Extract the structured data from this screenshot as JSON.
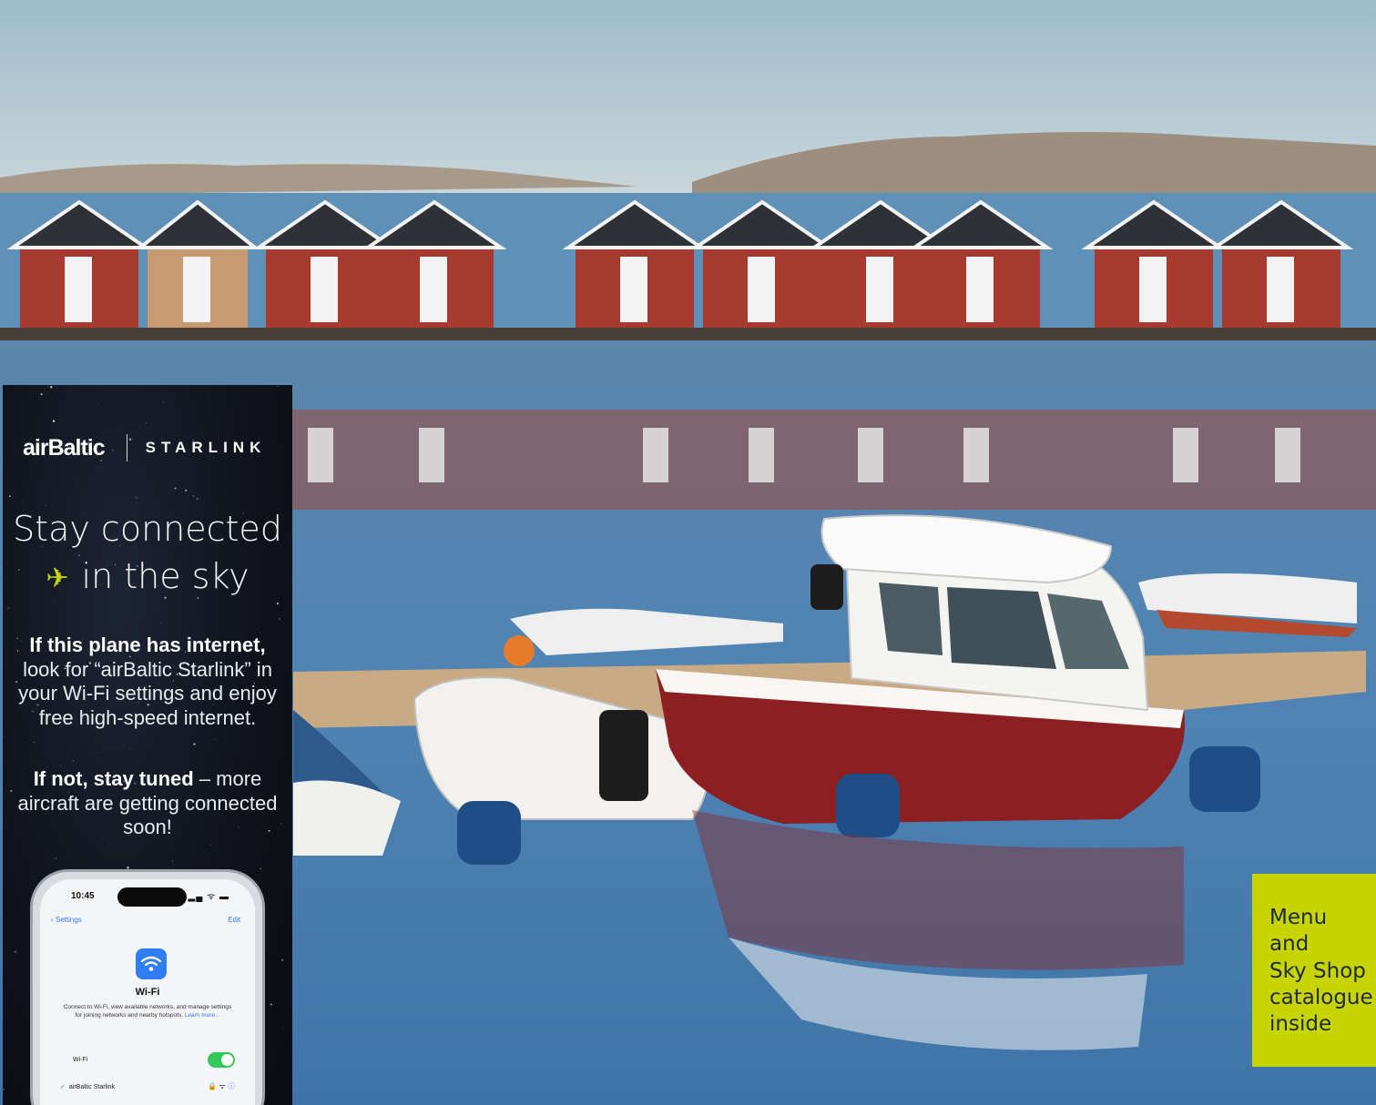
{
  "background": {
    "description_icon": "harbour-photo",
    "colors": {
      "sky": "#b7cad4",
      "water": "#5f8fb5",
      "boathouse": "#a63a2e",
      "roof": "#2e3236"
    }
  },
  "promo": {
    "brand": {
      "airline": "airBaltic",
      "partner": "STARLINK"
    },
    "headline": {
      "line1": "Stay connected",
      "line2": "in the sky",
      "icon": "airplane-icon"
    },
    "para1": {
      "bold": "If this plane has internet,",
      "text": "look for “airBaltic Starlink” in your Wi-Fi settings and enjoy free high-speed internet."
    },
    "para2": {
      "bold": "If not, stay tuned",
      "text": "– more aircraft are getting connected soon!"
    },
    "accent_color": "#c8d400"
  },
  "phone": {
    "time": "10:45",
    "status_icons": "▂▄ ᯤ ▬",
    "back_label": "Settings",
    "edit_label": "Edit",
    "title": "Wi-Fi",
    "description": "Connect to Wi-Fi, view available networks, and manage settings for joining networks and nearby hotspots.",
    "learn_more": "Learn more...",
    "wifi_row_label": "Wi-Fi",
    "wifi_enabled": true,
    "network_name": "airBaltic Starlink",
    "network_icons": "🔒 ᯤ",
    "info_icon": "ⓘ"
  },
  "badge": {
    "lines": [
      "Menu",
      "and",
      "Sky Shop",
      "catalogue",
      "inside"
    ],
    "color": "#c8d400"
  }
}
